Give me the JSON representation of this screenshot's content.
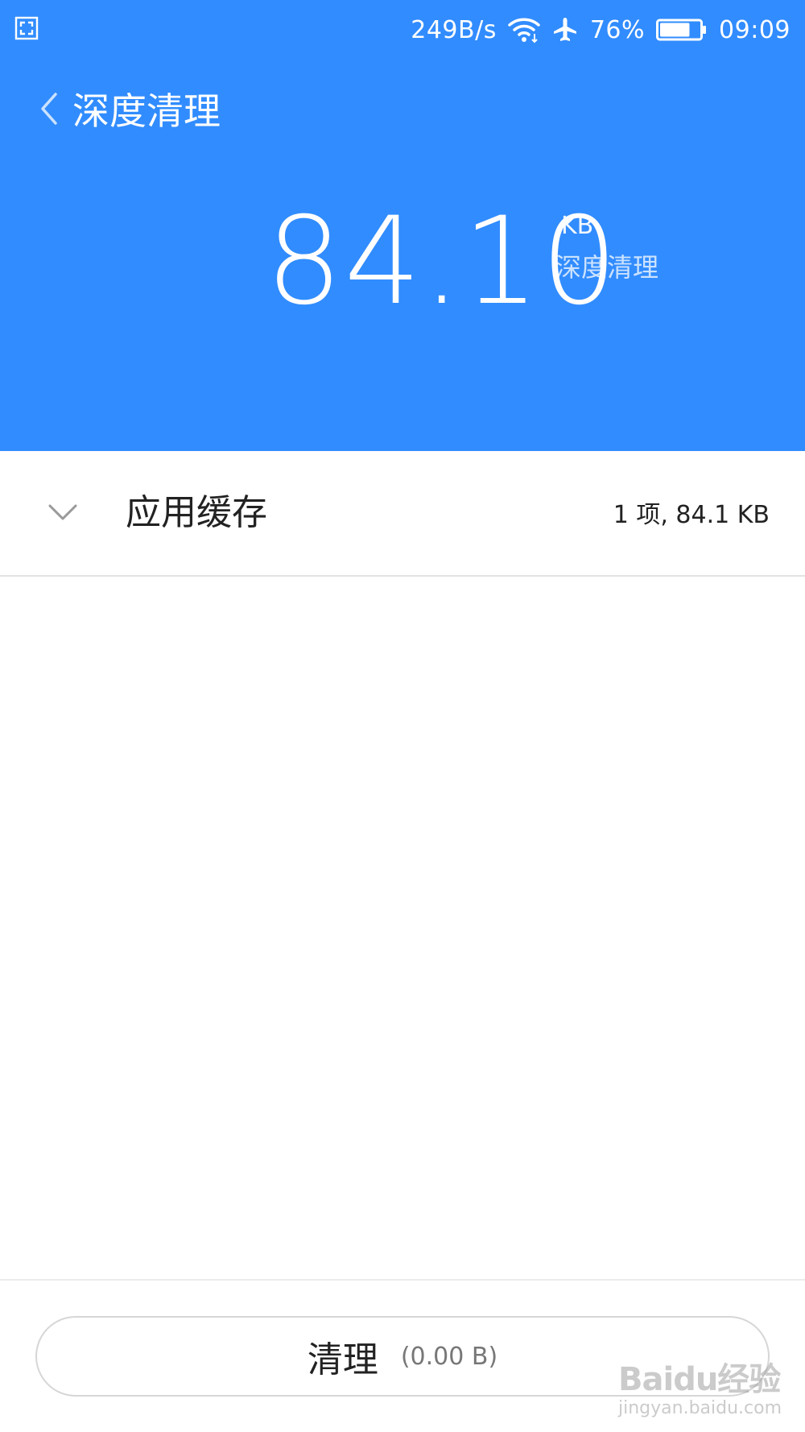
{
  "status_bar": {
    "net_speed": "249B/s",
    "battery_percent": "76%",
    "battery_level": 0.76,
    "time": "09:09",
    "icons": [
      "screenshot-icon",
      "wifi-icon",
      "airplane-icon",
      "battery-icon"
    ]
  },
  "header": {
    "title": "深度清理",
    "size_value": "84.10",
    "size_unit": "KB",
    "size_label": "深度清理",
    "background_color": "#318cff"
  },
  "list": {
    "items": [
      {
        "title": "应用缓存",
        "meta": "1 项, 84.1 KB",
        "expanded": false,
        "icon": "chevron-down-icon"
      }
    ]
  },
  "bottom": {
    "clean_label": "清理",
    "clean_size": "(0.00 B)"
  },
  "watermark": {
    "main": "Baidu经验",
    "sub": "jingyan.baidu.com"
  }
}
